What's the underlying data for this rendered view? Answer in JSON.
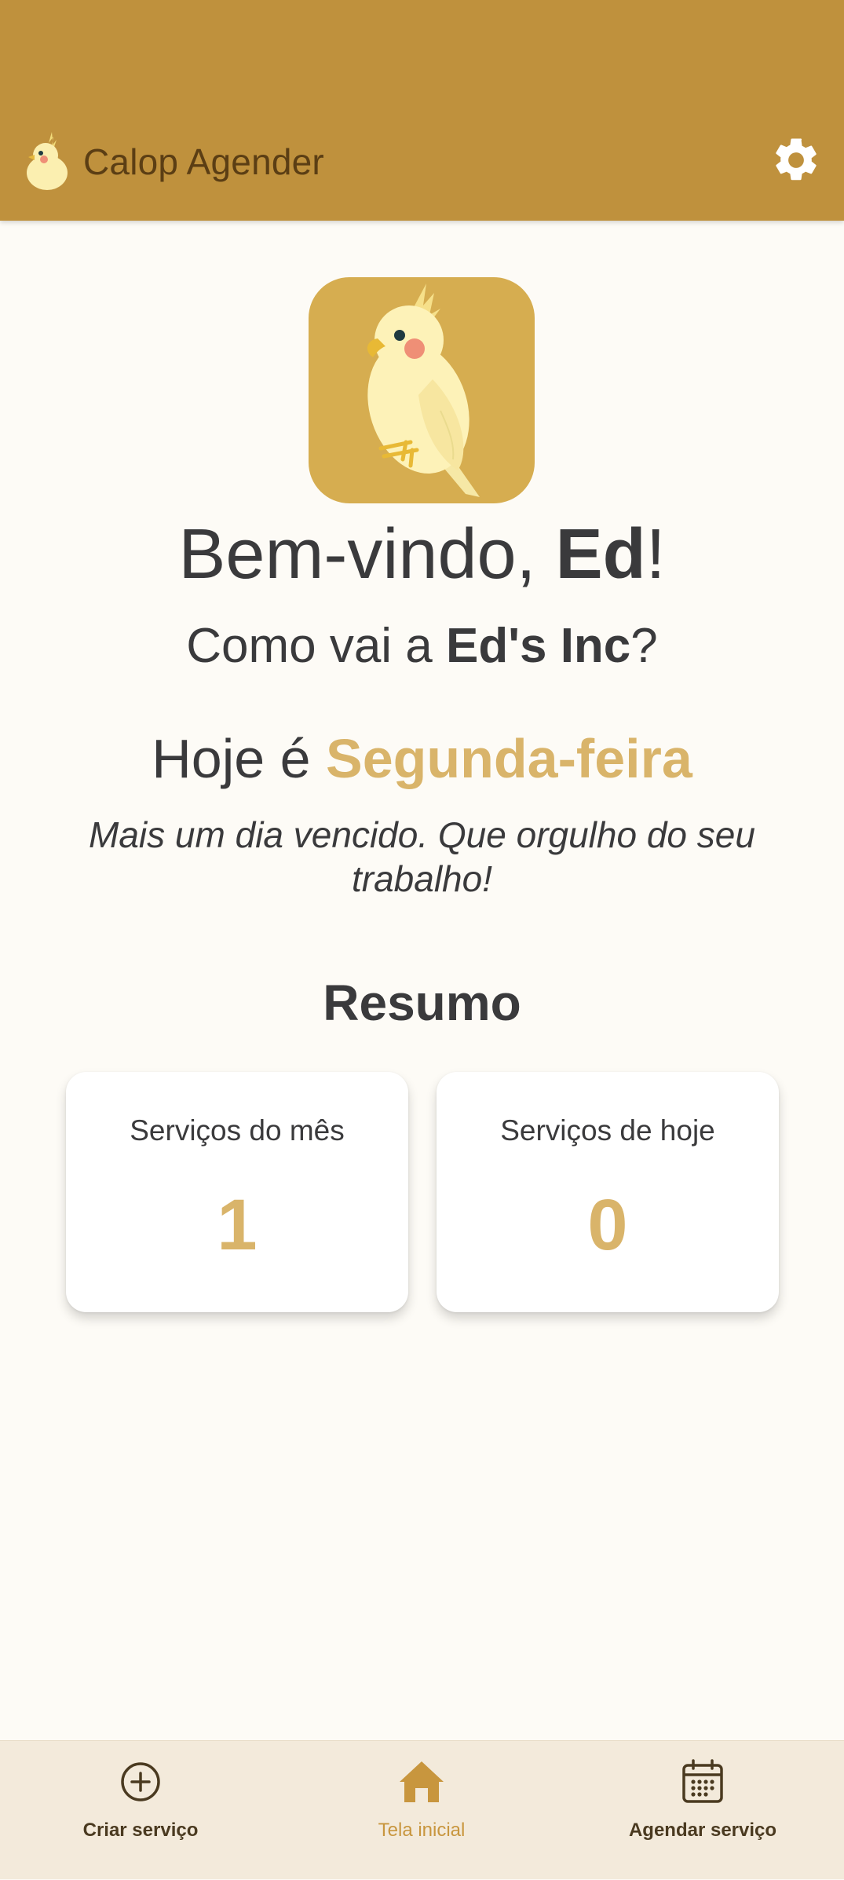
{
  "app_bar": {
    "title": "Calop Agender",
    "logo_icon": "cockatiel-logo-icon",
    "settings_icon": "gear-icon",
    "color": "#bf913d"
  },
  "main": {
    "hero_icon": "cockatiel-illustration-icon",
    "welcome_prefix": "Bem-vindo, ",
    "user_name": "Ed",
    "welcome_suffix": "!",
    "company_prefix": "Como vai a ",
    "company_name": "Ed's Inc",
    "company_suffix": "?",
    "today_prefix": "Hoje é ",
    "today_day": "Segunda-feira",
    "motivation": "Mais um dia vencido. Que orgulho do seu trabalho!",
    "summary_title": "Resumo",
    "cards": [
      {
        "label": "Serviços do mês",
        "value": "1"
      },
      {
        "label": "Serviços de hoje",
        "value": "0"
      }
    ],
    "accent_color": "#d9b46a"
  },
  "bottom_nav": {
    "items": [
      {
        "label": "Criar serviço",
        "icon": "plus-circle-icon",
        "active": false
      },
      {
        "label": "Tela inicial",
        "icon": "home-icon",
        "active": true
      },
      {
        "label": "Agendar serviço",
        "icon": "calendar-icon",
        "active": false
      }
    ],
    "background": "#f3eadb"
  }
}
